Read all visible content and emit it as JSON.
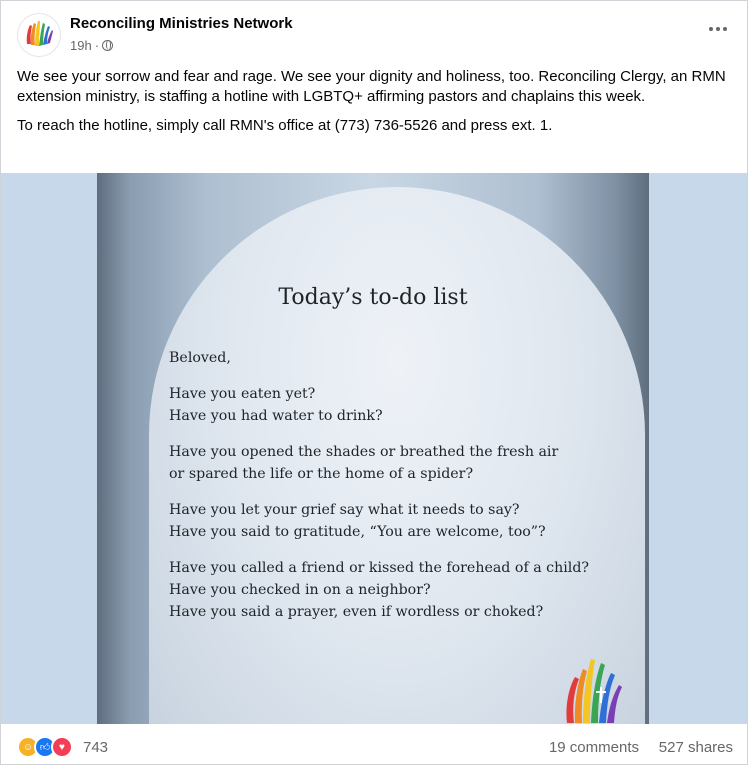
{
  "post": {
    "page_name": "Reconciling Ministries Network",
    "time": "19h",
    "separator": "·",
    "audience_icon": "globe-icon",
    "more_icon": "more-options-icon",
    "text_paragraphs": [
      "We see your sorrow and fear and rage. We see your dignity and holiness, too. Reconciling Clergy, an RMN extension ministry, is staffing a hotline with LGBTQ+ affirming pastors and chaplains this week.",
      "To reach the hotline, simply call RMN's office at (773) 736-5526 and press ext. 1."
    ]
  },
  "image": {
    "title": "Today’s to-do list",
    "lines": [
      "Beloved,",
      "",
      "Have you eaten yet?",
      "Have you had water to drink?",
      "",
      "Have you opened the shades or breathed the fresh air",
      "or spared the life or the home of a spider?",
      "",
      "Have you let your grief say what it needs to say?",
      "Have you said to gratitude, “You are welcome, too”?",
      "",
      "Have you called a friend or kissed the forehead of a child?",
      "Have you checked in on a neighbor?",
      "Have you said a prayer, even if wordless or choked?"
    ]
  },
  "footer": {
    "reactions": [
      "care-reaction-icon",
      "like-reaction-icon",
      "love-reaction-icon"
    ],
    "reaction_count": "743",
    "comments": "19 comments",
    "shares": "527 shares"
  },
  "colors": {
    "text_primary": "#050505",
    "text_secondary": "#65676b",
    "like_blue": "#1877f2",
    "love_red": "#f33e58",
    "care_yellow": "#f7b125"
  }
}
